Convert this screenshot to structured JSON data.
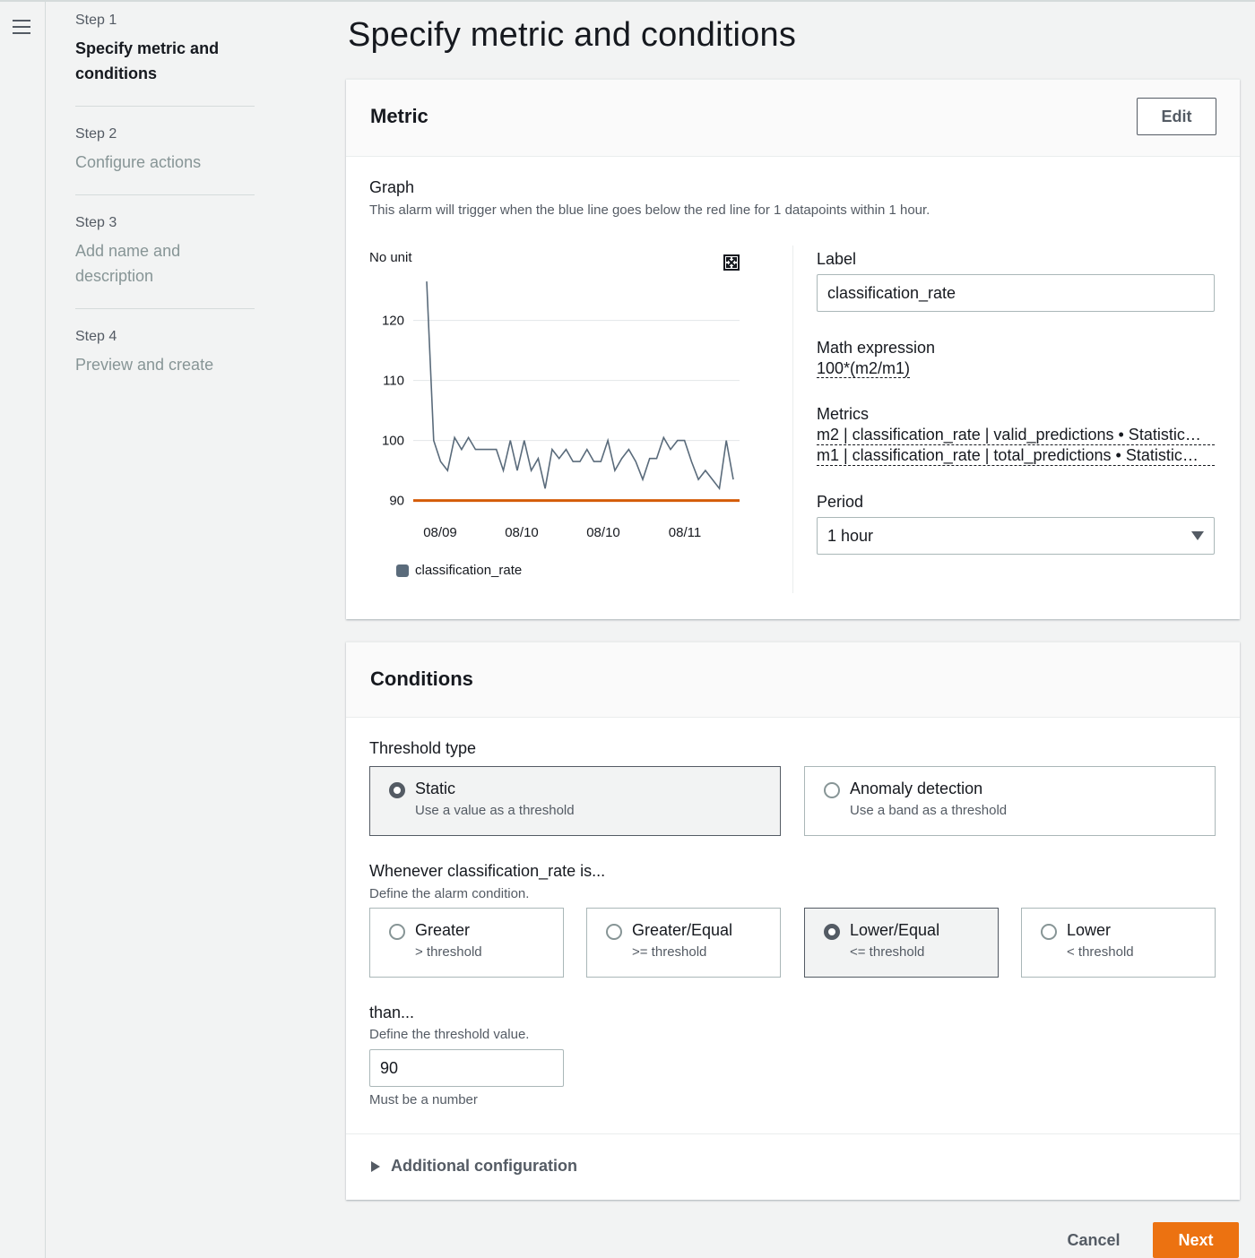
{
  "page": {
    "title": "Specify metric and conditions"
  },
  "steps": [
    {
      "num": "Step 1",
      "title": "Specify metric and conditions"
    },
    {
      "num": "Step 2",
      "title": "Configure actions"
    },
    {
      "num": "Step 3",
      "title": "Add name and description"
    },
    {
      "num": "Step 4",
      "title": "Preview and create"
    }
  ],
  "metric": {
    "header": "Metric",
    "edit_label": "Edit",
    "graph_label": "Graph",
    "graph_desc": "This alarm will trigger when the blue line goes below the red line for 1 datapoints within 1 hour.",
    "label_field": "Label",
    "label_value": "classification_rate",
    "math_label": "Math expression",
    "math_value": "100*(m2/m1)",
    "metrics_label": "Metrics",
    "metrics_items": [
      "m2 | classification_rate | valid_predictions • Statistic…",
      "m1 | classification_rate | total_predictions • Statistic…"
    ],
    "period_label": "Period",
    "period_value": "1 hour"
  },
  "chart_data": {
    "type": "line",
    "ylabel": "No unit",
    "yticks": [
      90,
      100,
      110,
      120
    ],
    "ylim": [
      88,
      128
    ],
    "xtick_labels": [
      "08/09",
      "08/10",
      "08/10",
      "08/11"
    ],
    "legend": [
      "classification_rate"
    ],
    "threshold": 90,
    "colors": {
      "series": "#5a6b7b",
      "threshold": "#d45b07",
      "grid": "#e3e6e8"
    },
    "series": [
      {
        "name": "classification_rate",
        "values": [
          126.5,
          100,
          96.5,
          95,
          100.5,
          98.5,
          100.5,
          98.5,
          98.5,
          98.5,
          98.5,
          95,
          100,
          95,
          100,
          95,
          97,
          92,
          98.5,
          97,
          98.5,
          96.5,
          96.5,
          98.5,
          96.5,
          96.5,
          100,
          95,
          97,
          98.5,
          96.5,
          93.5,
          97,
          97,
          100.5,
          98.5,
          100,
          100,
          96.5,
          93.5,
          95,
          93.5,
          92,
          100,
          93.5
        ]
      }
    ]
  },
  "conditions": {
    "header": "Conditions",
    "threshold_type_label": "Threshold type",
    "threshold_types": [
      {
        "title": "Static",
        "sub": "Use a value as a threshold",
        "selected": true
      },
      {
        "title": "Anomaly detection",
        "sub": "Use a band as a threshold",
        "selected": false
      }
    ],
    "whenever_label": "Whenever classification_rate is...",
    "whenever_desc": "Define the alarm condition.",
    "operators": [
      {
        "title": "Greater",
        "sub": "> threshold",
        "selected": false
      },
      {
        "title": "Greater/Equal",
        "sub": ">= threshold",
        "selected": false
      },
      {
        "title": "Lower/Equal",
        "sub": "<= threshold",
        "selected": true
      },
      {
        "title": "Lower",
        "sub": "< threshold",
        "selected": false
      }
    ],
    "than_label": "than...",
    "than_desc": "Define the threshold value.",
    "threshold_value": "90",
    "threshold_hint": "Must be a number",
    "additional": "Additional configuration"
  },
  "footer": {
    "cancel": "Cancel",
    "next": "Next"
  }
}
